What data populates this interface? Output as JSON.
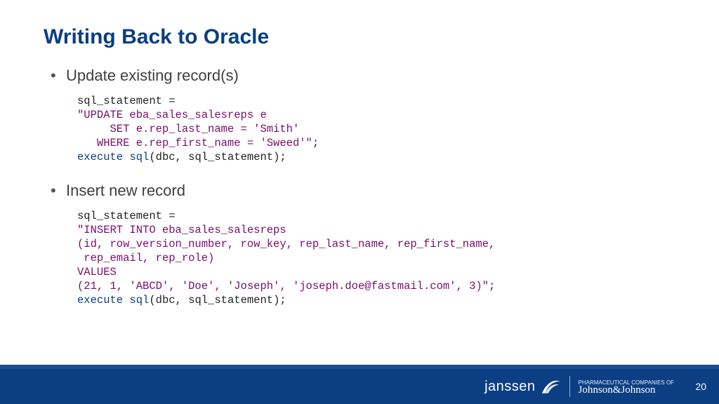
{
  "title": "Writing Back to Oracle",
  "bullets": {
    "b1": "Update existing record(s)",
    "b2": "Insert new record"
  },
  "code1": {
    "l1": "sql_statement =",
    "l2": "\"UPDATE eba_sales_salesreps e",
    "l3": "     SET e.rep_last_name = 'Smith'",
    "l4a": "   WHERE e.rep_first_name = 'Sweed'\"",
    "l4b": ";",
    "l5a": "execute",
    "l5b": " sql",
    "l5c": "(dbc, sql_statement);"
  },
  "code2": {
    "l1": "sql_statement =",
    "l2": "\"INSERT INTO eba_sales_salesreps",
    "l3": "(id, row_version_number, row_key, rep_last_name, rep_first_name,",
    "l4": " rep_email, rep_role)",
    "l5": "VALUES",
    "l6a": "(21, 1, 'ABCD', 'Doe', 'Joseph', 'joseph.doe@fastmail.com', 3)\"",
    "l6b": ";",
    "l7a": "execute",
    "l7b": " sql",
    "l7c": "(dbc, sql_statement);"
  },
  "footer": {
    "brand1": "janssen",
    "brand2_pre": "PHARMACEUTICAL COMPANIES OF",
    "brand2_script": "Johnson&Johnson",
    "page": "20"
  }
}
